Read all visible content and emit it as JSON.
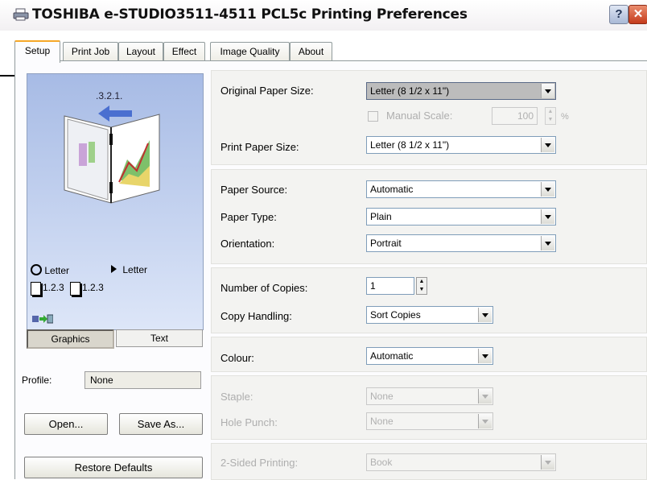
{
  "window": {
    "title": "TOSHIBA e-STUDIO3511-4511 PCL5c Printing Preferences",
    "help_label": "?",
    "close_label": "✕"
  },
  "tabs": [
    "Setup",
    "Print Job",
    "Layout",
    "Effect",
    "Image Quality",
    "About"
  ],
  "active_tab": "Setup",
  "preview": {
    "page_order_label": ".3.2.1.",
    "original_paper": "Letter",
    "print_paper": "Letter",
    "collate_a": "1.2.3",
    "collate_b": "1.2.3",
    "view_buttons": [
      "Graphics",
      "Text"
    ],
    "active_view": "Graphics"
  },
  "profile": {
    "label": "Profile:",
    "value": "None",
    "open_label": "Open...",
    "save_as_label": "Save As...",
    "restore_label": "Restore Defaults"
  },
  "paper": {
    "original_size_label": "Original Paper Size:",
    "original_size_value": "Letter (8 1/2 x 11\")",
    "manual_scale_label": "Manual Scale:",
    "manual_scale_value": "100",
    "manual_scale_unit": "%",
    "print_size_label": "Print Paper Size:",
    "print_size_value": "Letter (8 1/2 x 11\")"
  },
  "source": {
    "paper_source_label": "Paper Source:",
    "paper_source_value": "Automatic",
    "paper_type_label": "Paper Type:",
    "paper_type_value": "Plain",
    "orientation_label": "Orientation:",
    "orientation_value": "Portrait"
  },
  "copies": {
    "number_label": "Number of Copies:",
    "number_value": "1",
    "handling_label": "Copy Handling:",
    "handling_value": "Sort Copies"
  },
  "colour": {
    "label": "Colour:",
    "value": "Automatic"
  },
  "finishing": {
    "staple_label": "Staple:",
    "staple_value": "None",
    "hole_punch_label": "Hole Punch:",
    "hole_punch_value": "None"
  },
  "duplex": {
    "label": "2-Sided Printing:",
    "value": "Book"
  },
  "colors": {
    "titlebar_text": "#111111",
    "tab_highlight": "#f6a828",
    "preview_top": "#a7bbe5",
    "preview_bottom": "#dde6f8",
    "close_button": "#c43b1c"
  }
}
